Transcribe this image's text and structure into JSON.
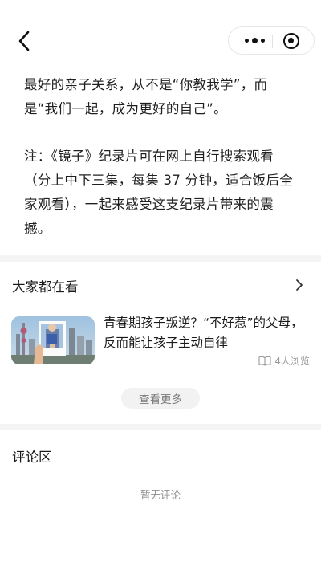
{
  "article": {
    "paragraph1": "最好的亲子关系，从不是“你教我学”，而是“我们一起，成为更好的自己”。",
    "paragraph2": "注：《镜子》纪录片可在网上自行搜索观看（分上中下三集，每集 37 分钟，适合饭后全家观看），一起来感受这支纪录片带来的震撼。"
  },
  "recommend": {
    "section_title": "大家都在看",
    "items": [
      {
        "title": "青春期孩子叛逆？“不好惹”的父母，反而能让孩子主动自律",
        "views": "4人浏览"
      }
    ],
    "more_label": "查看更多"
  },
  "comments": {
    "section_title": "评论区",
    "empty_text": "暂无评论"
  }
}
